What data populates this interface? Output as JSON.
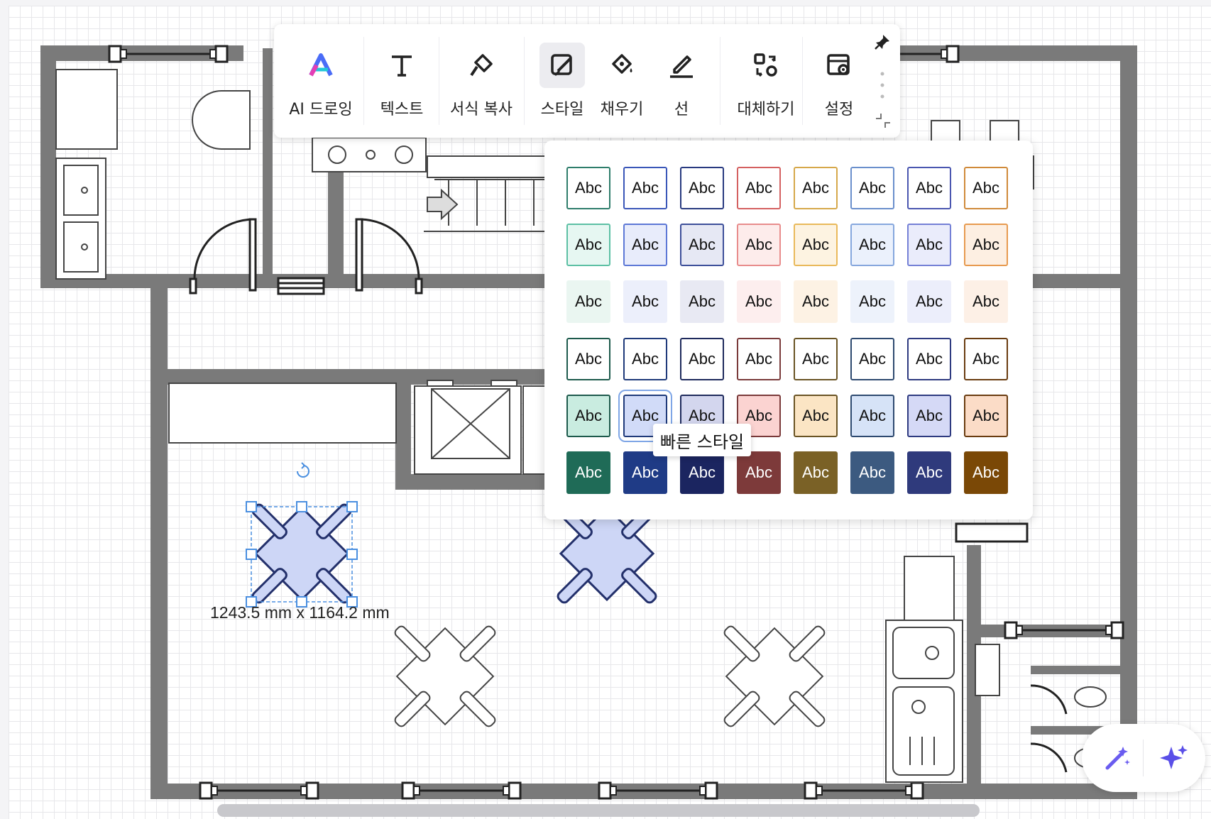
{
  "toolbar": {
    "tools": [
      {
        "label": "AI 드로잉",
        "icon": "ai-drawing-icon"
      },
      {
        "label": "텍스트",
        "icon": "text-icon"
      },
      {
        "label": "서식 복사",
        "icon": "format-painter-icon"
      },
      {
        "label": "스타일",
        "icon": "style-icon",
        "active": true
      },
      {
        "label": "채우기",
        "icon": "fill-bucket-icon"
      },
      {
        "label": "선",
        "icon": "line-pen-icon"
      },
      {
        "label": "대체하기",
        "icon": "replace-icon"
      },
      {
        "label": "설정",
        "icon": "settings-icon"
      }
    ],
    "pin_icon": "pin-icon",
    "collapse_icon": "collapse-icon"
  },
  "style_panel": {
    "swatch_label": "Abc",
    "rows": [
      [
        {
          "bg": "#ffffff",
          "border": "#2e7d6b",
          "text": "#111111"
        },
        {
          "bg": "#ffffff",
          "border": "#3a56b8",
          "text": "#111111"
        },
        {
          "bg": "#ffffff",
          "border": "#283a80",
          "text": "#111111"
        },
        {
          "bg": "#ffffff",
          "border": "#d46060",
          "text": "#111111"
        },
        {
          "bg": "#ffffff",
          "border": "#d6a84a",
          "text": "#111111"
        },
        {
          "bg": "#ffffff",
          "border": "#6a8fcc",
          "text": "#111111"
        },
        {
          "bg": "#ffffff",
          "border": "#4a56b0",
          "text": "#111111"
        },
        {
          "bg": "#ffffff",
          "border": "#d08a3a",
          "text": "#111111"
        }
      ],
      [
        {
          "bg": "#e6f7f2",
          "border": "#5cc0a4",
          "text": "#111111"
        },
        {
          "bg": "#e8ecfb",
          "border": "#5d78d6",
          "text": "#111111"
        },
        {
          "bg": "#e6e8f4",
          "border": "#3d4f9a",
          "text": "#111111"
        },
        {
          "bg": "#fdeceb",
          "border": "#e88c8c",
          "text": "#111111"
        },
        {
          "bg": "#fdf3e1",
          "border": "#e9b95a",
          "text": "#111111"
        },
        {
          "bg": "#ebf1fc",
          "border": "#86a7dd",
          "text": "#111111"
        },
        {
          "bg": "#eaecfb",
          "border": "#7480d6",
          "text": "#111111"
        },
        {
          "bg": "#fdefe2",
          "border": "#e79a4f",
          "text": "#111111"
        }
      ],
      [
        {
          "bg": "#eaf6f1",
          "border": "#eaf6f1",
          "text": "#111111"
        },
        {
          "bg": "#eceffb",
          "border": "#eceffb",
          "text": "#111111"
        },
        {
          "bg": "#e8e9f3",
          "border": "#e8e9f3",
          "text": "#111111"
        },
        {
          "bg": "#fdeeee",
          "border": "#fdeeee",
          "text": "#111111"
        },
        {
          "bg": "#fdf2e4",
          "border": "#fdf2e4",
          "text": "#111111"
        },
        {
          "bg": "#edf2fb",
          "border": "#edf2fb",
          "text": "#111111"
        },
        {
          "bg": "#eceefb",
          "border": "#eceefb",
          "text": "#111111"
        },
        {
          "bg": "#fdf0e6",
          "border": "#fdf0e6",
          "text": "#111111"
        }
      ],
      [
        {
          "bg": "#ffffff",
          "border": "#1d5a4c",
          "text": "#111111"
        },
        {
          "bg": "#ffffff",
          "border": "#1f3a7a",
          "text": "#111111"
        },
        {
          "bg": "#ffffff",
          "border": "#1e2a5c",
          "text": "#111111"
        },
        {
          "bg": "#ffffff",
          "border": "#7a3a3a",
          "text": "#111111"
        },
        {
          "bg": "#ffffff",
          "border": "#6a5424",
          "text": "#111111"
        },
        {
          "bg": "#ffffff",
          "border": "#2e4a70",
          "text": "#111111"
        },
        {
          "bg": "#ffffff",
          "border": "#2e3a80",
          "text": "#111111"
        },
        {
          "bg": "#ffffff",
          "border": "#6a3c10",
          "text": "#111111"
        }
      ],
      [
        {
          "bg": "#c9ece0",
          "border": "#1d5a4c",
          "text": "#111111"
        },
        {
          "bg": "#d1dbf8",
          "border": "#1f3a7a",
          "text": "#111111",
          "selected": true
        },
        {
          "bg": "#d3d6ee",
          "border": "#1e2a5c",
          "text": "#111111"
        },
        {
          "bg": "#fbd3d1",
          "border": "#7a3a3a",
          "text": "#111111"
        },
        {
          "bg": "#fbe5c4",
          "border": "#6a5424",
          "text": "#111111"
        },
        {
          "bg": "#d6e3f7",
          "border": "#2e4a70",
          "text": "#111111"
        },
        {
          "bg": "#d5d9f6",
          "border": "#2e3a80",
          "text": "#111111"
        },
        {
          "bg": "#fbdcc7",
          "border": "#6a3c10",
          "text": "#111111"
        }
      ],
      [
        {
          "bg": "#1f6b57",
          "border": "#1f6b57",
          "text": "#ffffff"
        },
        {
          "bg": "#1f3b86",
          "border": "#1f3b86",
          "text": "#ffffff"
        },
        {
          "bg": "#1b2560",
          "border": "#1b2560",
          "text": "#ffffff"
        },
        {
          "bg": "#7d3a3a",
          "border": "#7d3a3a",
          "text": "#ffffff"
        },
        {
          "bg": "#7a6126",
          "border": "#7a6126",
          "text": "#ffffff"
        },
        {
          "bg": "#3c5a80",
          "border": "#3c5a80",
          "text": "#ffffff"
        },
        {
          "bg": "#2f3a7c",
          "border": "#2f3a7c",
          "text": "#ffffff"
        },
        {
          "bg": "#7a4806",
          "border": "#7a4806",
          "text": "#ffffff"
        }
      ]
    ]
  },
  "tooltip": {
    "text": "빠른 스타일"
  },
  "selection": {
    "dimensions": "1243.5 mm x 1164.2 mm"
  },
  "ai_buttons": {
    "left_icon": "magic-wand-icon",
    "right_icon": "sparkle-icon"
  },
  "colors": {
    "wall": "#7a7a7a",
    "selected_fill": "#cdd6f6",
    "selected_stroke": "#23306b",
    "handle": "#4a8fe0"
  }
}
